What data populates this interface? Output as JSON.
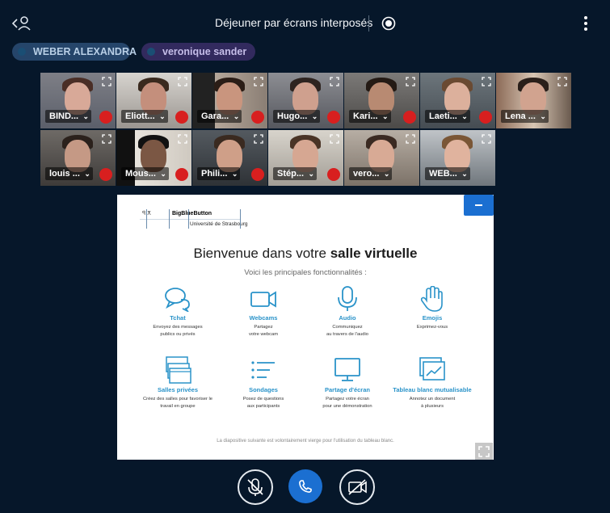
{
  "header": {
    "title": "Déjeuner par écrans interposés",
    "icons": [
      "user-list-icon",
      "record-icon",
      "kebab-menu-icon"
    ]
  },
  "talkers": [
    "WEBER ALEXANDRA",
    "veronique sander"
  ],
  "videos": [
    {
      "name": "BIND..."
    },
    {
      "name": "Eliott..."
    },
    {
      "name": "Gara..."
    },
    {
      "name": "Hugo..."
    },
    {
      "name": "Kari..."
    },
    {
      "name": "Laeti..."
    },
    {
      "name": "Lena ..."
    },
    {
      "name": "louis ..."
    },
    {
      "name": "Mous..."
    },
    {
      "name": "Phili..."
    },
    {
      "name": "Stép..."
    },
    {
      "name": "vero..."
    },
    {
      "name": "WEB..."
    }
  ],
  "presentation": {
    "logo_brand": "BigBlueButton",
    "logo_org": "Université de Strasbourg",
    "title_normal": "Bienvenue dans votre ",
    "title_bold": "salle virtuelle",
    "subtitle": "Voici les principales fonctionnalités :",
    "features": [
      {
        "name": "Tchat",
        "desc": "Envoyez des messages\npublics ou privés",
        "icon": "chat-icon"
      },
      {
        "name": "Webcams",
        "desc": "Partagez\nvotre webcam",
        "icon": "webcam-icon"
      },
      {
        "name": "Audio",
        "desc": "Communiquez\nau travers de l'audio",
        "icon": "microphone-icon"
      },
      {
        "name": "Emojis",
        "desc": "Exprimez-vous",
        "icon": "hand-icon"
      },
      {
        "name": "Salles privées",
        "desc": "Créez des salles pour favoriser le\ntravail en groupe",
        "icon": "breakout-rooms-icon"
      },
      {
        "name": "Sondages",
        "desc": "Posez de questions\naux participants",
        "icon": "poll-icon"
      },
      {
        "name": "Partage d'écran",
        "desc": "Partagez votre écran\npour une démonstration",
        "icon": "screen-share-icon"
      },
      {
        "name": "Tableau blanc mutualisable",
        "desc": "Annotez un document\nà plusieurs",
        "icon": "whiteboard-icon"
      }
    ],
    "footer": "La diapositive suivante est volontairement vierge pour l'utilisation du tableau blanc."
  },
  "controls": [
    "microphone-muted-icon",
    "phone-icon",
    "camera-off-icon"
  ],
  "colors": {
    "background": "#06172a",
    "accent": "#1b6fd1",
    "mute_red": "#d81f1f",
    "feature_blue": "#2a93c9"
  }
}
